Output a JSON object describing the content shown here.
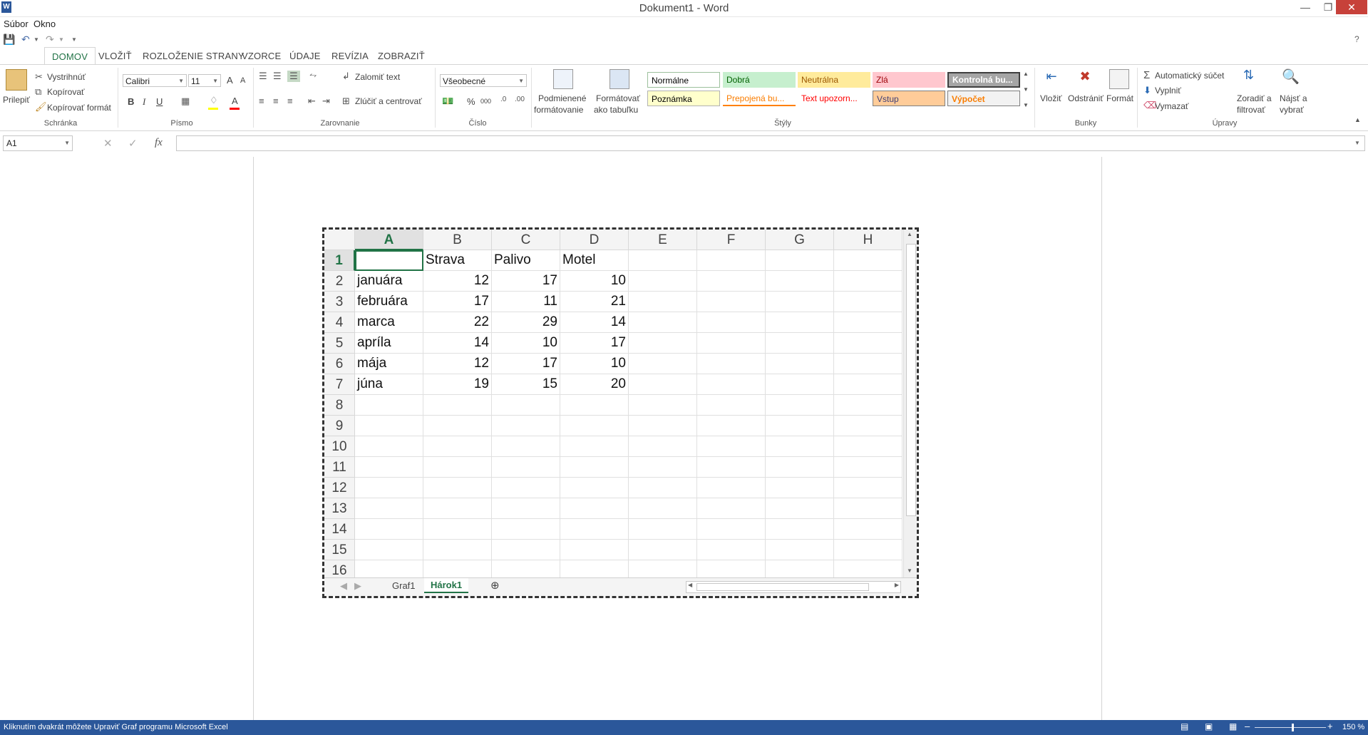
{
  "window": {
    "title": "Dokument1 - Word",
    "icon": "word-icon"
  },
  "menubar": [
    "Súbor",
    "Okno"
  ],
  "ribbon_tabs": [
    "DOMOV",
    "VLOŽIŤ",
    "ROZLOŽENIE STRANY",
    "VZORCE",
    "ÚDAJE",
    "REVÍZIA",
    "ZOBRAZIŤ"
  ],
  "active_tab": "DOMOV",
  "help": "?",
  "clipboard": {
    "paste": "Prilepiť",
    "cut": "Vystrihnúť",
    "copy": "Kopírovať",
    "format_painter": "Kopírovať formát",
    "group": "Schránka"
  },
  "font": {
    "name": "Calibri",
    "size": "11",
    "bold": "B",
    "italic": "I",
    "underline": "U",
    "grow": "A",
    "shrink": "A",
    "group": "Písmo",
    "fill_color": "#ffff00",
    "text_color": "#ff0000"
  },
  "alignment": {
    "wrap": "Zalomiť text",
    "merge": "Zlúčiť a centrovať",
    "group": "Zarovnanie"
  },
  "number": {
    "format": "Všeobecné",
    "percent": "%",
    "thousands": "000",
    "group": "Číslo"
  },
  "styles": {
    "conditional": [
      "Podmienené",
      "formátovanie"
    ],
    "as_table": [
      "Formátovať",
      "ako tabuľku"
    ],
    "items": [
      {
        "label": "Normálne",
        "bg": "#ffffff",
        "fg": "#000000"
      },
      {
        "label": "Dobrá",
        "bg": "#c6efce",
        "fg": "#006100"
      },
      {
        "label": "Neutrálna",
        "bg": "#ffeb9c",
        "fg": "#9c5700"
      },
      {
        "label": "Zlá",
        "bg": "#ffc7ce",
        "fg": "#9c0006"
      },
      {
        "label": "Kontrolná bu...",
        "bg": "#a5a5a5",
        "fg": "#ffffff"
      },
      {
        "label": "Poznámka",
        "bg": "#ffffcc",
        "fg": "#000000"
      },
      {
        "label": "Prepojená bu...",
        "bg": "#ffffff",
        "fg": "#fa7d00"
      },
      {
        "label": "Text upozorn...",
        "bg": "#ffffff",
        "fg": "#ff0000"
      },
      {
        "label": "Vstup",
        "bg": "#ffcc99",
        "fg": "#3f3f76"
      },
      {
        "label": "Výpočet",
        "bg": "#f2f2f2",
        "fg": "#fa7d00"
      }
    ],
    "group": "Štýly"
  },
  "cells_group": {
    "insert": "Vložiť",
    "delete": "Odstrániť",
    "format": "Formát",
    "group": "Bunky"
  },
  "editing": {
    "autosum": "Automatický súčet",
    "fill": "Vyplniť",
    "clear": "Vymazať",
    "sort": [
      "Zoradiť a",
      "filtrovať"
    ],
    "find": [
      "Nájsť a",
      "vybrať"
    ],
    "group": "Úpravy"
  },
  "formula_bar": {
    "name_box": "A1",
    "fx": "fx",
    "value": ""
  },
  "sheet": {
    "columns": [
      "A",
      "B",
      "C",
      "D",
      "E",
      "F",
      "G",
      "H"
    ],
    "active_column": "A",
    "active_row": "1",
    "rows": [
      {
        "num": "1",
        "cells": [
          "",
          "Strava",
          "Palivo",
          "Motel"
        ]
      },
      {
        "num": "2",
        "cells": [
          "januára",
          "12",
          "17",
          "10"
        ]
      },
      {
        "num": "3",
        "cells": [
          "februára",
          "17",
          "11",
          "21"
        ]
      },
      {
        "num": "4",
        "cells": [
          "marca",
          "22",
          "29",
          "14"
        ]
      },
      {
        "num": "5",
        "cells": [
          "apríla",
          "14",
          "10",
          "17"
        ]
      },
      {
        "num": "6",
        "cells": [
          "mája",
          "12",
          "17",
          "10"
        ]
      },
      {
        "num": "7",
        "cells": [
          "júna",
          "19",
          "15",
          "20"
        ]
      },
      {
        "num": "8",
        "cells": [
          "",
          "",
          "",
          ""
        ]
      },
      {
        "num": "9",
        "cells": [
          "",
          "",
          "",
          ""
        ]
      },
      {
        "num": "10",
        "cells": [
          "",
          "",
          "",
          ""
        ]
      },
      {
        "num": "11",
        "cells": [
          "",
          "",
          "",
          ""
        ]
      },
      {
        "num": "12",
        "cells": [
          "",
          "",
          "",
          ""
        ]
      },
      {
        "num": "13",
        "cells": [
          "",
          "",
          "",
          ""
        ]
      },
      {
        "num": "14",
        "cells": [
          "",
          "",
          "",
          ""
        ]
      },
      {
        "num": "15",
        "cells": [
          "",
          "",
          "",
          ""
        ]
      },
      {
        "num": "16",
        "cells": [
          "",
          "",
          "",
          ""
        ]
      }
    ],
    "tabs": [
      "Graf1",
      "Hárok1"
    ],
    "active_sheet": "Hárok1"
  },
  "status": {
    "message": "Kliknutím dvakrát môžete Upraviť Graf programu Microsoft Excel",
    "zoom": "150 %"
  }
}
